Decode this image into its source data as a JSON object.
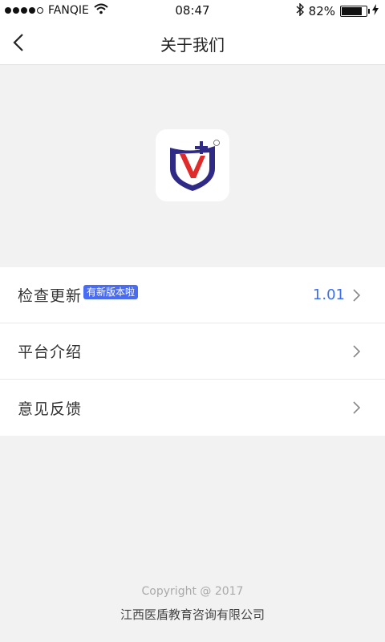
{
  "status_bar": {
    "carrier": "FANQIE",
    "time": "08:47",
    "battery_percent": "82%",
    "battery_level": 0.82,
    "signal_icon": "signal-dots-icon",
    "wifi_icon": "wifi-icon",
    "bluetooth_icon": "bluetooth-icon",
    "charging_icon": "charging-bolt-icon"
  },
  "nav": {
    "title": "关于我们",
    "back_icon": "chevron-left-icon"
  },
  "logo": {
    "icon": "app-logo-shield-icon",
    "colors": {
      "navy": "#2e2a86",
      "red": "#e02b2b"
    }
  },
  "menu": {
    "items": [
      {
        "label": "检查更新",
        "badge": "有新版本啦",
        "value": "1.01"
      },
      {
        "label": "平台介绍"
      },
      {
        "label": "意见反馈"
      }
    ]
  },
  "footer": {
    "copyright": "Copyright @ 2017",
    "company": "江西医盾教育咨询有限公司"
  },
  "colors": {
    "accent": "#3a6df0",
    "badge": "#4a6cf0",
    "background": "#f2f2f2"
  }
}
